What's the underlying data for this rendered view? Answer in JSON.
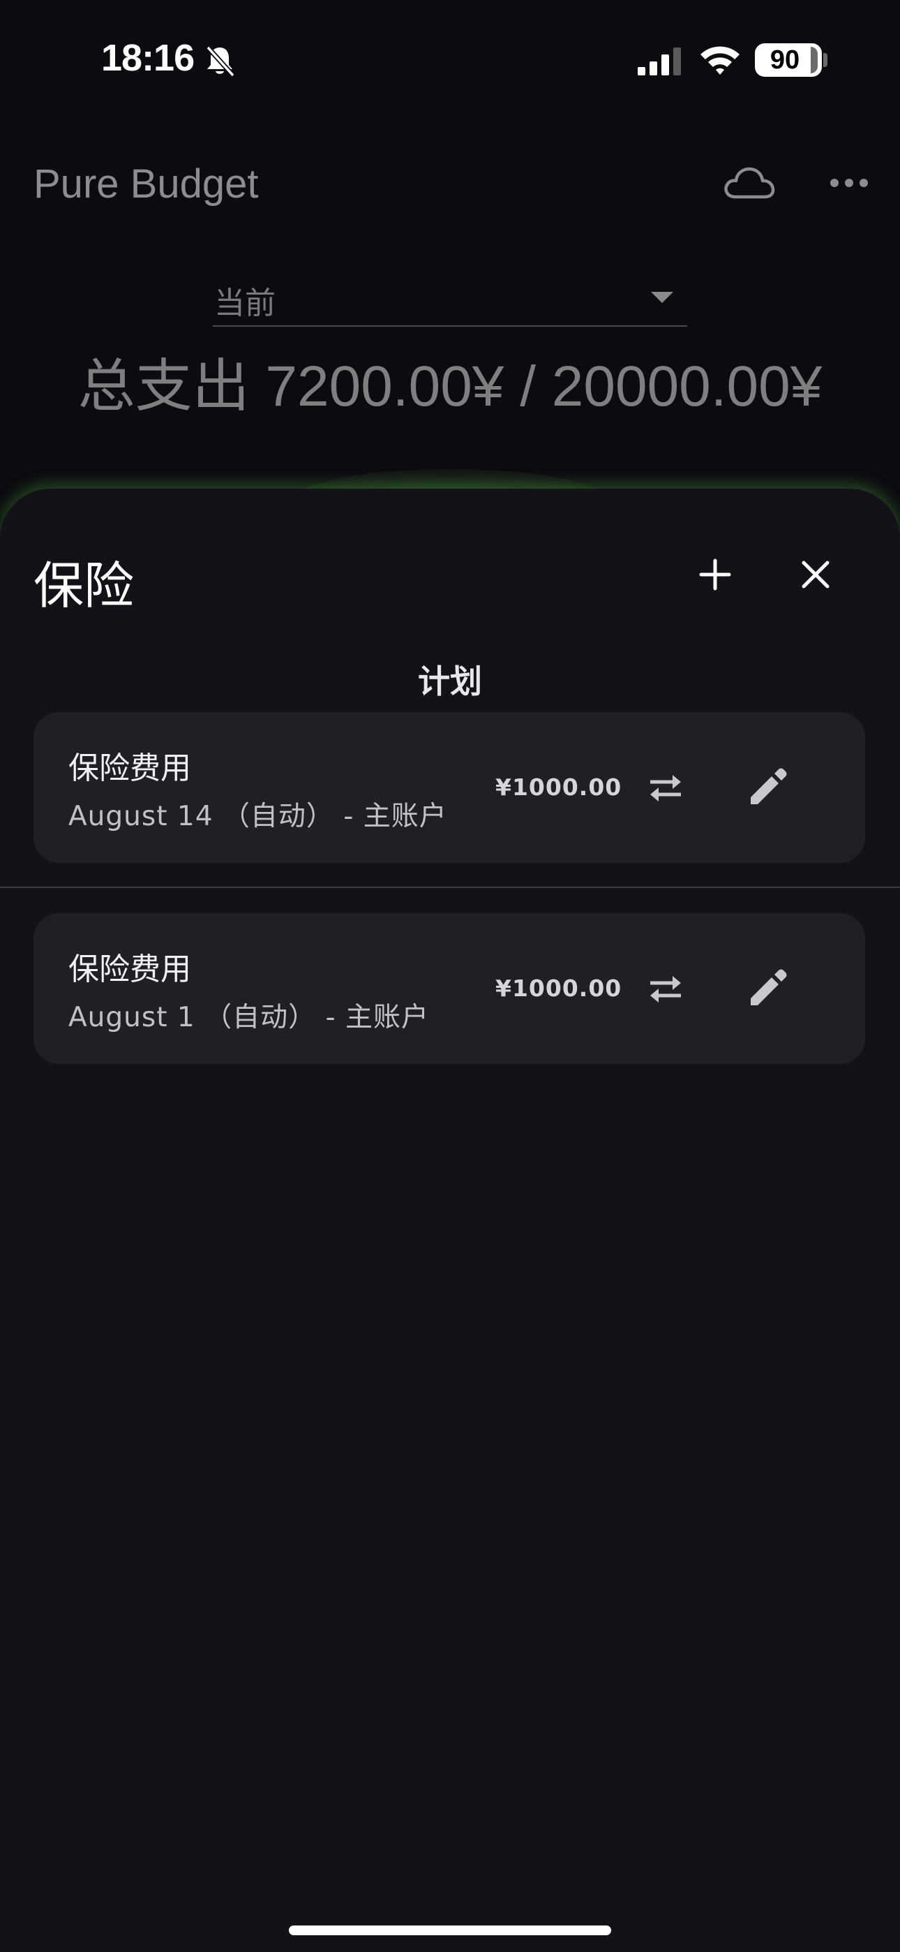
{
  "status_bar": {
    "time": "18:16",
    "battery_level": "90",
    "icons": [
      "bell-slash-icon",
      "cellular-signal-icon",
      "wifi-icon",
      "battery-icon"
    ]
  },
  "app": {
    "title": "Pure Budget",
    "icons": [
      "cloud-icon",
      "more-horizontal-icon"
    ],
    "period_select": {
      "value": "当前"
    },
    "total_summary": "总支出 7200.00¥ / 20000.00¥"
  },
  "sheet": {
    "title": "保险",
    "icons": [
      "plus-icon",
      "close-icon"
    ],
    "section_header": "计划",
    "plans": [
      {
        "name": "保险费用",
        "detail": "August 14 （自动） - 主账户",
        "amount": "¥1000.00"
      },
      {
        "name": "保险费用",
        "detail": "August 1 （自动） - 主账户",
        "amount": "¥1000.00"
      }
    ],
    "plan_icons": [
      "transfer-arrows-icon",
      "pencil-icon"
    ],
    "accent_glow_color": "#5ac846"
  }
}
